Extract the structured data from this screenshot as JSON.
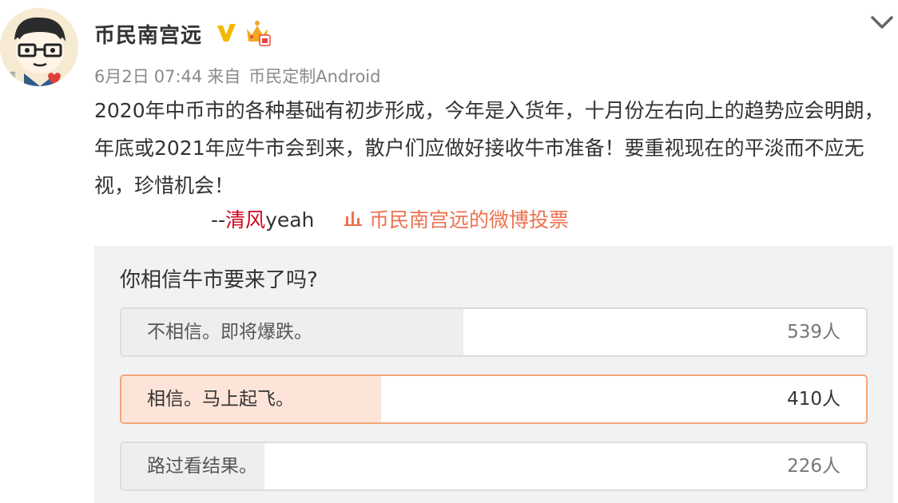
{
  "user": {
    "name": "币民南宫远",
    "avatar_icon": "cartoon-avatar-icon"
  },
  "meta": {
    "date": "6月2日",
    "time": "07:44",
    "from": "来自",
    "device": "币民定制Android"
  },
  "post": {
    "text": "2020年中币市的各种基础有初步形成，今年是入货年，十月份左右向上的趋势应会明朗，年底或2021年应牛市会到来，散户们应做好接收牛市准备！要重视现在的平淡而不应无视，珍惜机会！",
    "signature_prefix": "--",
    "signature_highlight": "清风",
    "signature_suffix": "yeah",
    "vote_link": "币民南宫远的微博投票"
  },
  "poll": {
    "question": "你相信牛市要来了吗?",
    "options": [
      {
        "label": "不相信。即将爆跌。",
        "count": "539人",
        "fill": 0.459,
        "selected": false
      },
      {
        "label": "相信。马上起飞。",
        "count": "410人",
        "fill": 0.349,
        "selected": true
      },
      {
        "label": "路过看结果。",
        "count": "226人",
        "fill": 0.192,
        "selected": false
      }
    ]
  },
  "colors": {
    "accent": "#eb7350",
    "highlight_red": "#d0021b",
    "verified_gold": "#f5b800"
  }
}
